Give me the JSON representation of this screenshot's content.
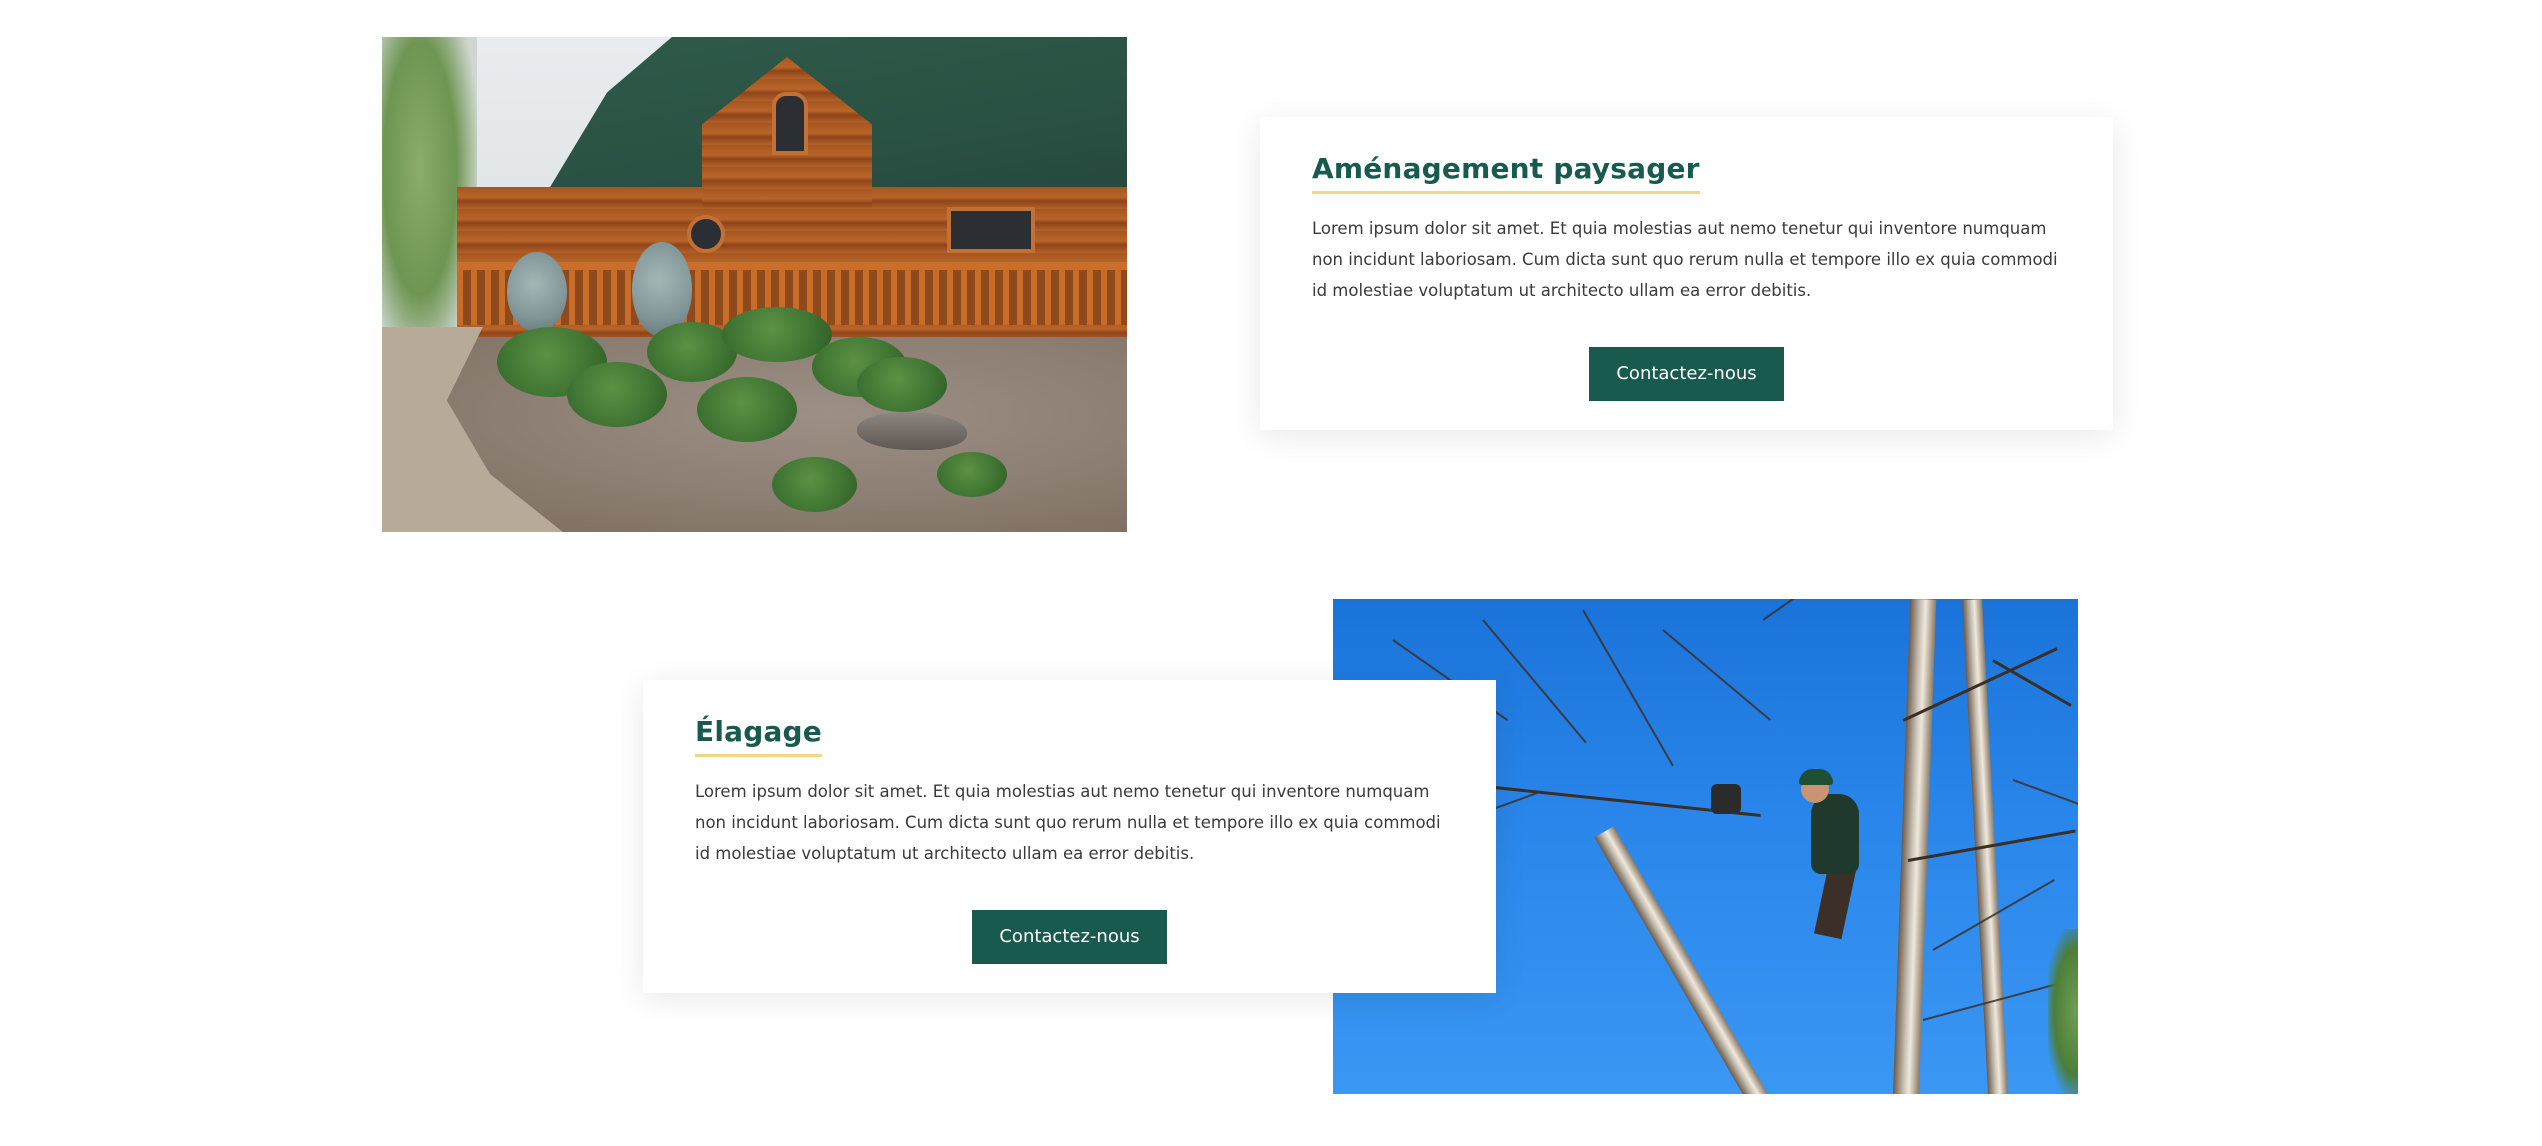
{
  "sections": [
    {
      "title": "Aménagement paysager",
      "text": "Lorem ipsum dolor sit amet. Et quia molestias aut nemo tenetur qui inventore numquam non incidunt laboriosam. Cum dicta sunt quo rerum nulla et tempore illo ex quia commodi id molestiae voluptatum ut architecto ullam ea error debitis.",
      "button_label": "Contactez-nous"
    },
    {
      "title": "Élagage",
      "text": "Lorem ipsum dolor sit amet. Et quia molestias aut nemo tenetur qui inventore numquam non incidunt laboriosam. Cum dicta sunt quo rerum nulla et tempore illo ex quia commodi id molestiae voluptatum ut architecto ullam ea error debitis.",
      "button_label": "Contactez-nous"
    }
  ],
  "colors": {
    "brand_green": "#185a4e",
    "title_underline": "#f3d58a",
    "body_text": "#3a3a3a"
  }
}
